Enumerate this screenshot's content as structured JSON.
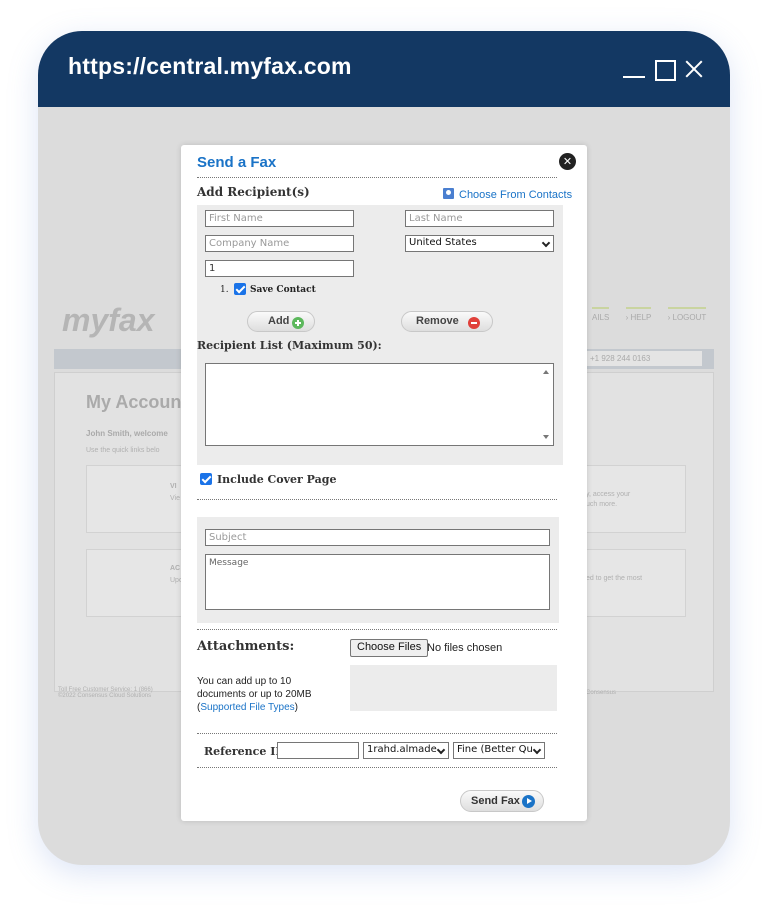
{
  "window": {
    "url": "https://central.myfax.com"
  },
  "background": {
    "logo": "myfax",
    "nav_tabs": [
      "AILS",
      "› HELP",
      "› LOGOUT"
    ],
    "phone": "+1 928 244 0163",
    "heading": "My Account",
    "welcome": "John Smith, welcome",
    "quick_links": "Use the quick links belo",
    "card1_title": "VI",
    "card1_text": "Vie",
    "card1_side": "y, access your",
    "card1_side2": "uch more.",
    "card2_title": "AC",
    "card2_text": "Upc",
    "card2_side": "ed to get the most",
    "footer1": "Toll Free Customer Service: 1 (866)",
    "footer2": "©2022 Consensus Cloud Solutions",
    "footer_right": "Consensus"
  },
  "modal": {
    "title": "Send a Fax",
    "add_recipients_label": "Add Recipient(s)",
    "choose_contacts": "Choose From Contacts",
    "first_name_placeholder": "First Name",
    "last_name_placeholder": "Last Name",
    "company_placeholder": "Company Name",
    "country": "United States",
    "fax_number_value": "1",
    "row_number": "1.",
    "save_contact": "Save Contact",
    "add_label": "Add",
    "remove_label": "Remove",
    "recipient_list_label": "Recipient List (Maximum 50):",
    "include_cover": "Include Cover Page",
    "subject_placeholder": "Subject",
    "message_placeholder": "Message",
    "attachments_label": "Attachments:",
    "choose_files": "Choose Files",
    "no_files": "No files chosen",
    "attach_note": "You can add up to 10 documents or up to 20MB",
    "attach_link_open": "(",
    "supported_types": "Supported File Types",
    "attach_link_close": ")",
    "reference_label": "Reference ID:",
    "reference_value": "",
    "user_select": "1rahd.almade",
    "quality_select": "Fine (Better Qu",
    "send_label": "Send Fax"
  },
  "colors": {
    "titlebar": "#133863",
    "link": "#1a73c7",
    "add_icon": "#5cb85c",
    "remove_icon": "#e0403a"
  }
}
